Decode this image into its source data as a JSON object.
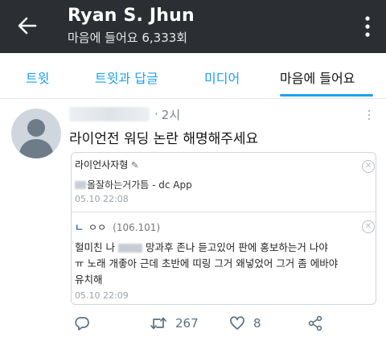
{
  "header": {
    "title": "Ryan S. Jhun",
    "subtitle": "마음에 들어요 6,333회",
    "background": "#2b2f33"
  },
  "tabs": [
    {
      "label": "트윗",
      "active": false
    },
    {
      "label": "트윗과 답글",
      "active": false
    },
    {
      "label": "미디어",
      "active": false
    },
    {
      "label": "마음에 들어요",
      "active": true
    }
  ],
  "accent_color": "#1da1f2",
  "tweet": {
    "separator": "·",
    "time": "2시",
    "text": "라이언전 워딩 논란 해명해주세요",
    "card": {
      "post_title": "라이언사자형",
      "post_title_icon": "✎",
      "source_text": "올잘하는거가틈 - dc App",
      "date": "05.10 22:08",
      "comment": {
        "marker": "ㄴ",
        "nickname": "ㅇㅇ",
        "ip": "(106.101)",
        "line1_prefix": "헐미친 나",
        "line1_suffix": "망과후 존나 듣고있어 판에 홍보하는거 나야",
        "line2": "ㅠ 노래 개좋아 근데 초반에 띠링 그거 왜넣었어 그거 좀 에바야",
        "line3": "유치해",
        "date": "05.10 22:09"
      }
    },
    "actions": {
      "retweets": "267",
      "likes": "8"
    }
  }
}
